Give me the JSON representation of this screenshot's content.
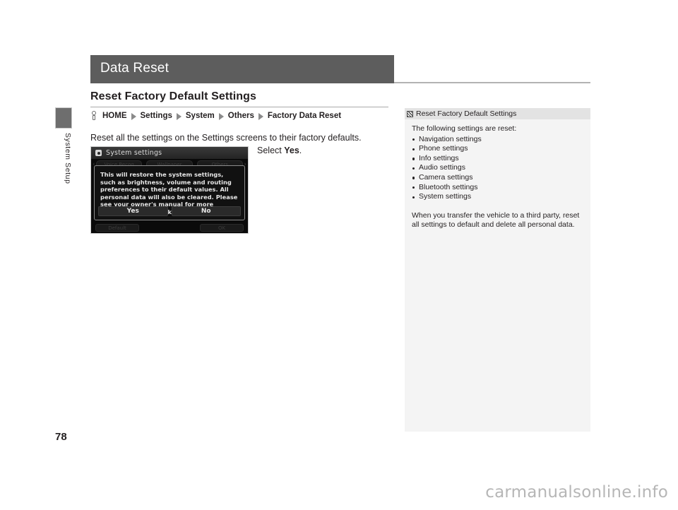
{
  "page": {
    "title": "Data Reset",
    "number": "78",
    "watermark": "carmanualsonline.info"
  },
  "sidebar_tab": {
    "label": "System Setup"
  },
  "section": {
    "heading": "Reset Factory Default Settings"
  },
  "breadcrumb": {
    "icon": "nav-home-icon",
    "crumbs": [
      "HOME",
      "Settings",
      "System",
      "Others",
      "Factory Data Reset"
    ],
    "separator": "▶"
  },
  "body": {
    "intro": "Reset all the settings on the Settings screens to their factory defaults.",
    "select_prefix": "Select ",
    "select_strong": "Yes",
    "select_suffix": "."
  },
  "device": {
    "title": "System settings",
    "title_icon": "gear-icon",
    "background_tabs": [
      "Voice Recog",
      "Wallpaper",
      "Others"
    ],
    "scroll_left": "‹",
    "scroll_right": "›",
    "dialog_message": "This will restore the system settings, such as brightness, volume and routing preferences to their default values. All personal data will also be cleared. Please see your owner's manual for more details. Would you like to continue?",
    "buttons": [
      "Yes",
      "No"
    ],
    "bottom_buttons": [
      "Default",
      "OK"
    ]
  },
  "side_panel": {
    "icon": "hatched-square-icon",
    "title": "Reset Factory Default Settings",
    "lead": "The following settings are reset:",
    "items": [
      "Navigation settings",
      "Phone settings",
      "Info settings",
      "Audio settings",
      "Camera settings",
      "Bluetooth settings",
      "System settings"
    ],
    "note": "When you transfer the vehicle to a third party, reset all settings to default and delete all personal data."
  },
  "colors": {
    "header_bar": "#5d5d5d",
    "side_tab": "#6e6e6e",
    "panel_bg": "#f4f4f4",
    "panel_header": "#e3e3e3",
    "text": "#231f20",
    "watermark": "#b6b6b6"
  }
}
